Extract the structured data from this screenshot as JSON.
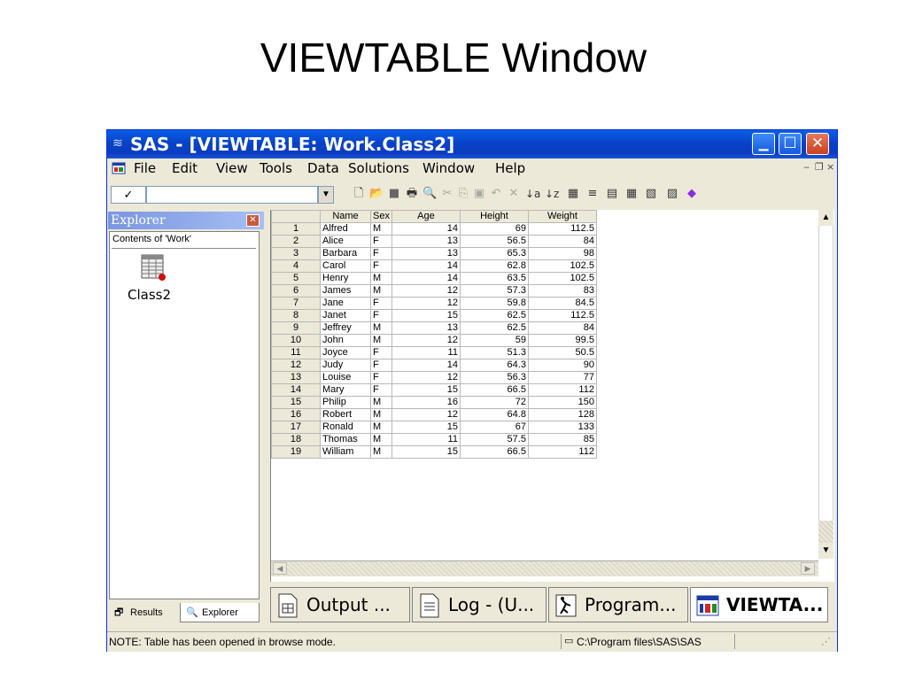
{
  "slide": {
    "title": "VIEWTABLE Window"
  },
  "window": {
    "title": "SAS - [VIEWTABLE: Work.Class2]"
  },
  "menu": [
    "File",
    "Edit",
    "View",
    "Tools",
    "Data",
    "Solutions",
    "Window",
    "Help"
  ],
  "toolbar": {
    "command_check": "✓",
    "command_value": ""
  },
  "explorer": {
    "title": "Explorer",
    "contents_label": "Contents of 'Work'",
    "item_label": "Class2",
    "tabs": {
      "results": "Results",
      "explorer": "Explorer"
    }
  },
  "table": {
    "headers": [
      "Name",
      "Sex",
      "Age",
      "Height",
      "Weight"
    ],
    "rows": [
      [
        "1",
        "Alfred",
        "M",
        "14",
        "69",
        "112.5"
      ],
      [
        "2",
        "Alice",
        "F",
        "13",
        "56.5",
        "84"
      ],
      [
        "3",
        "Barbara",
        "F",
        "13",
        "65.3",
        "98"
      ],
      [
        "4",
        "Carol",
        "F",
        "14",
        "62.8",
        "102.5"
      ],
      [
        "5",
        "Henry",
        "M",
        "14",
        "63.5",
        "102.5"
      ],
      [
        "6",
        "James",
        "M",
        "12",
        "57.3",
        "83"
      ],
      [
        "7",
        "Jane",
        "F",
        "12",
        "59.8",
        "84.5"
      ],
      [
        "8",
        "Janet",
        "F",
        "15",
        "62.5",
        "112.5"
      ],
      [
        "9",
        "Jeffrey",
        "M",
        "13",
        "62.5",
        "84"
      ],
      [
        "10",
        "John",
        "M",
        "12",
        "59",
        "99.5"
      ],
      [
        "11",
        "Joyce",
        "F",
        "11",
        "51.3",
        "50.5"
      ],
      [
        "12",
        "Judy",
        "F",
        "14",
        "64.3",
        "90"
      ],
      [
        "13",
        "Louise",
        "F",
        "12",
        "56.3",
        "77"
      ],
      [
        "14",
        "Mary",
        "F",
        "15",
        "66.5",
        "112"
      ],
      [
        "15",
        "Philip",
        "M",
        "16",
        "72",
        "150"
      ],
      [
        "16",
        "Robert",
        "M",
        "12",
        "64.8",
        "128"
      ],
      [
        "17",
        "Ronald",
        "M",
        "15",
        "67",
        "133"
      ],
      [
        "18",
        "Thomas",
        "M",
        "11",
        "57.5",
        "85"
      ],
      [
        "19",
        "William",
        "M",
        "15",
        "66.5",
        "112"
      ]
    ]
  },
  "tasks": [
    "Output ...",
    "Log - (U...",
    "Program...",
    "VIEWTA..."
  ],
  "status": {
    "message": "NOTE: Table has been opened in browse mode.",
    "path": "C:\\Program files\\SAS\\SAS"
  }
}
